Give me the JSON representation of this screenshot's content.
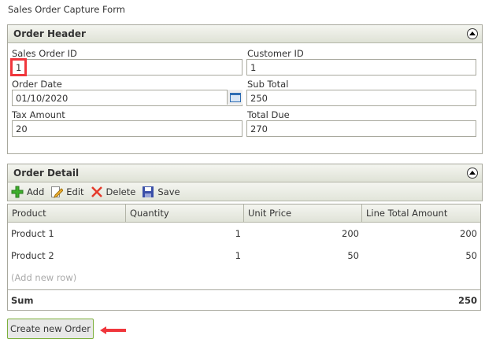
{
  "title": "Sales Order Capture Form",
  "order_header": {
    "title": "Order Header",
    "fields": {
      "sales_order_id": {
        "label": "Sales Order ID",
        "value": "1"
      },
      "customer_id": {
        "label": "Customer ID",
        "value": "1"
      },
      "order_date": {
        "label": "Order Date",
        "value": "01/10/2020"
      },
      "sub_total": {
        "label": "Sub Total",
        "value": "250"
      },
      "tax_amount": {
        "label": "Tax Amount",
        "value": "20"
      },
      "total_due": {
        "label": "Total Due",
        "value": "270"
      }
    }
  },
  "order_detail": {
    "title": "Order Detail",
    "toolbar": {
      "add": "Add",
      "edit": "Edit",
      "delete": "Delete",
      "save": "Save"
    },
    "columns": [
      "Product",
      "Quantity",
      "Unit Price",
      "Line Total Amount"
    ],
    "rows": [
      [
        "Product 1",
        "1",
        "200",
        "200"
      ],
      [
        "Product 2",
        "1",
        "50",
        "50"
      ]
    ],
    "add_row": "(Add new row)",
    "sum_label": "Sum",
    "sum_value": "250"
  },
  "create_button": "Create new Order",
  "colors": {
    "highlight": "#f0363c",
    "button_border": "#7cb03c"
  }
}
